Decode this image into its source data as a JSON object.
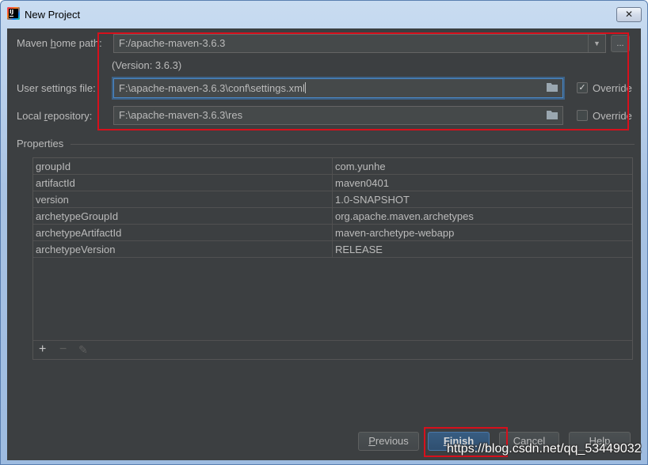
{
  "window": {
    "title": "New Project",
    "close_glyph": "✕",
    "app_icon_text": "IJ"
  },
  "form": {
    "maven_home": {
      "label_before": "Maven ",
      "label_underlined": "h",
      "label_after": "ome path:",
      "value": "F:/apache-maven-3.6.3",
      "version": "(Version: 3.6.3)",
      "browse": "..."
    },
    "user_settings": {
      "label": "User settings file:",
      "value": "F:\\apache-maven-3.6.3\\conf\\settings.xml",
      "override_label": "Override",
      "override_checked": true
    },
    "local_repo": {
      "label_before": "Local ",
      "label_underlined": "r",
      "label_after": "epository:",
      "value": "F:\\apache-maven-3.6.3\\res",
      "override_label": "Override",
      "override_checked": false
    }
  },
  "properties": {
    "title": "Properties",
    "rows": [
      {
        "key": "groupId",
        "value": "com.yunhe"
      },
      {
        "key": "artifactId",
        "value": "maven0401"
      },
      {
        "key": "version",
        "value": "1.0-SNAPSHOT"
      },
      {
        "key": "archetypeGroupId",
        "value": "org.apache.maven.archetypes"
      },
      {
        "key": "archetypeArtifactId",
        "value": "maven-archetype-webapp"
      },
      {
        "key": "archetypeVersion",
        "value": "RELEASE"
      }
    ],
    "toolbar": {
      "add": "+",
      "remove": "−",
      "edit": "✎"
    }
  },
  "buttons": {
    "previous": {
      "u": "P",
      "rest": "revious"
    },
    "finish": {
      "u": "F",
      "rest": "inish"
    },
    "cancel": "Cancel",
    "help": "Help"
  },
  "watermark": "https://blog.csdn.net/qq_53449032",
  "colors": {
    "background": "#3c3f41",
    "annotation": "#d6101c",
    "focus": "#4a88c7"
  }
}
